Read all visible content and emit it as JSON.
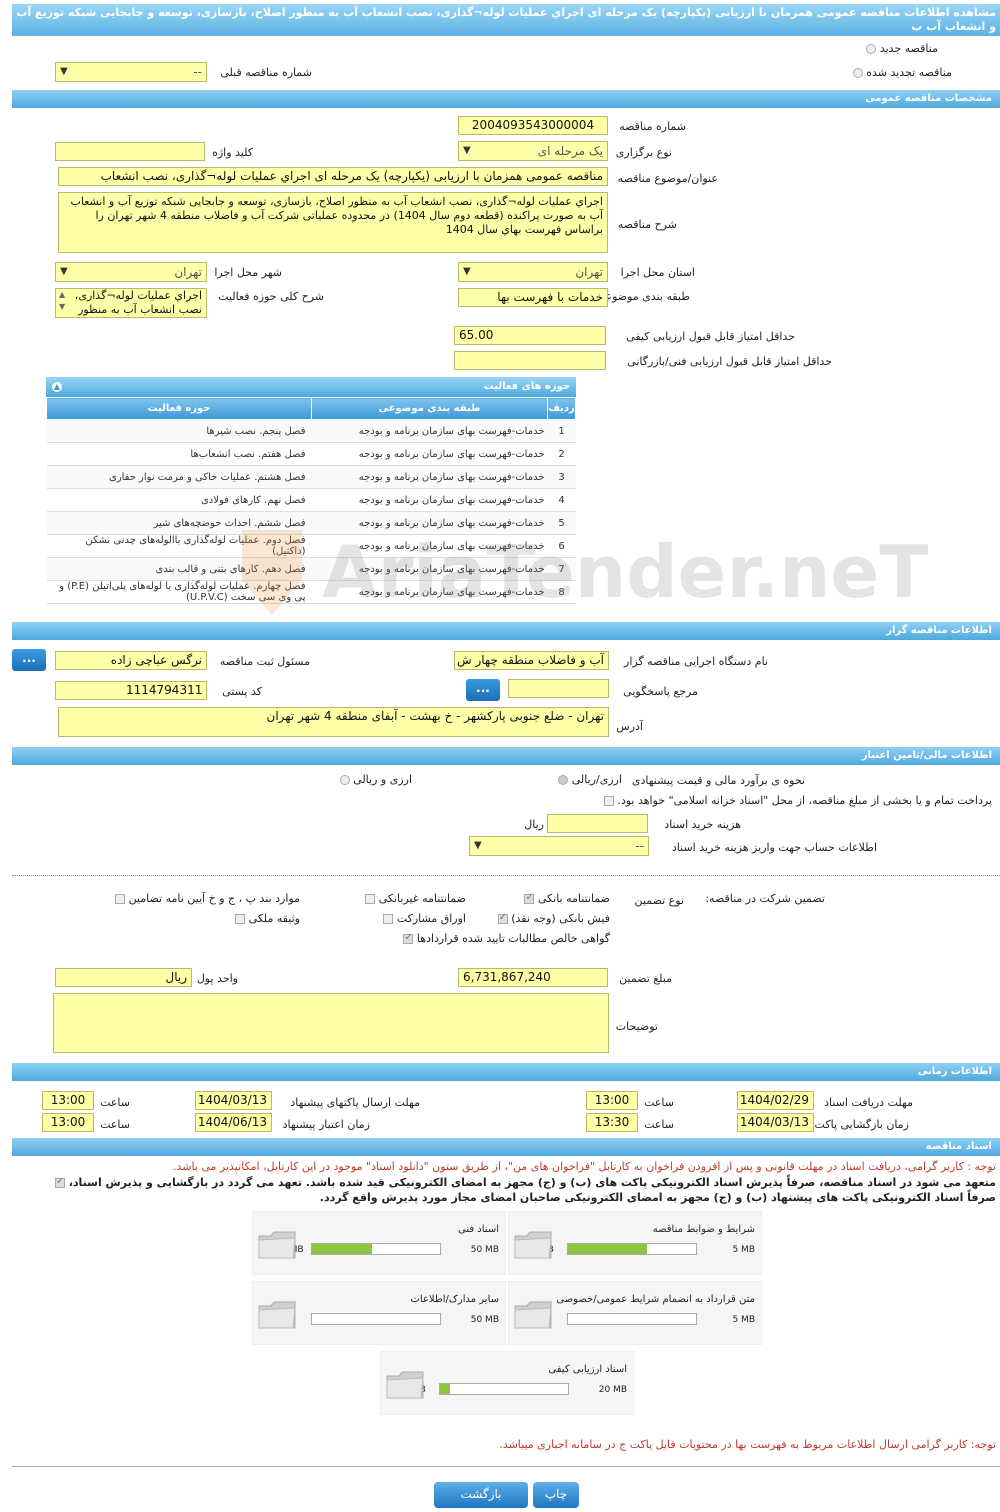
{
  "header": {
    "title": "مشاهده اطلاعات مناقصه عمومی همزمان با ارزیابی (یکپارچه) یک مرحله ای اجراي عمليات لوله¬گذاری، نصب انشعاب آب به منظور اصلاح، بازسازی، توسعه و جابجایی شبکه توزیع آب و انشعاب آب ب"
  },
  "top": {
    "new_tender": "مناقصه جدید",
    "renewed_tender": "مناقصه تجدید شده",
    "previous_number_label": "شماره مناقصه قبلی",
    "previous_number_value": "--"
  },
  "general": {
    "section": "مشخصات مناقصه عمومی",
    "number_label": "شماره مناقصه",
    "number": "2004093543000004",
    "type_label": "نوع برگزاری",
    "type": "یک مرحله ای",
    "keyword_label": "کلید واژه",
    "keyword": "",
    "title_label": "عنوان/موضوع مناقصه",
    "title": "مناقصه عمومی همزمان با ارزیابی (یکپارچه) یک مرحله ای اجراي عمليات لوله¬گذاری، نصب انشعاب",
    "desc_label": "شرح مناقصه",
    "desc": "اجراي عمليات لوله¬گذاری، نصب انشعاب آب به منظور اصلاح، بازسازی، توسعه و جابجایی شبکه توزیع آب و انشعاب آب به صورت پراکنده (قطعه دوم سال 1404) در محدوده عملیاتی شرکت آب و فاضلاب منطقه 4 شهر تهران را براساس فهرست بهاي سال 1404",
    "province_label": "استان محل اجرا",
    "province": "تهران",
    "city_label": "شهر محل اجرا",
    "city": "تهران",
    "category_label": "طبقه بندی موضوعی",
    "category": "خدمات با فهرست بها",
    "scope_label": "شرح کلی حوزه فعالیت",
    "scope": "اجراي عمليات لوله¬گذاری، نصب انشعاب آب به منظور",
    "min_quality_label": "حداقل امتیاز قابل قبول ارزیابی کیفی",
    "min_quality": "65.00",
    "min_tech_label": "حداقل امتیاز قابل قبول ارزیابی فنی/بازرگانی",
    "min_tech": ""
  },
  "activities": {
    "title": "حوزه های فعالیت",
    "col_row": "ردیف",
    "col_category": "طبقه بندی موضوعی",
    "col_field": "حوزه فعالیت",
    "rows": [
      {
        "n": "1",
        "cat": "خدمات-فهرست بهای سازمان برنامه و بودجه",
        "field": "فصل پنجم. نصب شيرها"
      },
      {
        "n": "2",
        "cat": "خدمات-فهرست بهای سازمان برنامه و بودجه",
        "field": "فصل هفتم. نصب انشعاب‌ها"
      },
      {
        "n": "3",
        "cat": "خدمات-فهرست بهای سازمان برنامه و بودجه",
        "field": "فصل هشتم. عملیات خاکی و مرمت نوار حفاری"
      },
      {
        "n": "4",
        "cat": "خدمات-فهرست بهای سازمان برنامه و بودجه",
        "field": "فصل نهم. کارهای فولادی"
      },
      {
        "n": "5",
        "cat": "خدمات-فهرست بهای سازمان برنامه و بودجه",
        "field": "فصل ششم. احداث حوضچه‌های شير"
      },
      {
        "n": "6",
        "cat": "خدمات-فهرست بهای سازمان برنامه و بودجه",
        "field": "فصل دوم. عملیات لوله‌گذاری باالوله‌های چدنی نشکن (داکتیل)"
      },
      {
        "n": "7",
        "cat": "خدمات-فهرست بهای سازمان برنامه و بودجه",
        "field": "فصل دهم. کارهای بتنی و قالب بندی"
      },
      {
        "n": "8",
        "cat": "خدمات-فهرست بهای سازمان برنامه و بودجه",
        "field": "فصل چهارم. عملیات لوله‌گذاری با لوله‌های پلی‌اتیلن (P.E) و پی وی سی سخت (U.P.V.C)"
      }
    ]
  },
  "org": {
    "section": "اطلاعات مناقصه گزار",
    "device_label": "نام دستگاه اجرایی مناقصه گزار",
    "device": "آب و فاضلاب منطقه چهار ش",
    "registrar_label": "مسئول ثبت مناقصه",
    "registrar": "نرگس عباچی زاده",
    "ref_label": "مرجع پاسخگویی",
    "ref": "",
    "postal_label": "کد پستی",
    "postal": "1114794311",
    "address_label": "آدرس",
    "address": "تهران - ضلع جنوبی پارکشهر - خ بهشت - آبفای منطقه 4 شهر تهران",
    "more": "..."
  },
  "finance": {
    "section": "اطلاعات مالی/تامین اعتبار",
    "estimate_label": "نحوه ی برآورد مالی و قیمت پیشنهادی",
    "opt1": "ارزی/ریالی",
    "opt2": "ارزی و ریالی",
    "treasury": "پرداخت تمام و یا بخشی از مبلغ مناقصه، از محل \"اسناد خزانه اسلامی\" خواهد بود.",
    "doc_cost_label": "هزینه خرید اسناد",
    "doc_cost": "",
    "doc_cost_unit": "ریال",
    "account_label": "اطلاعات حساب جهت واریز هزینه خرید اسناد",
    "account": "--"
  },
  "guarantee": {
    "participation_label": "تضمین شرکت در مناقصه:",
    "type_label": "نوع تضمین",
    "bank_guarantee": "ضمانتنامه بانکی",
    "nonbank_guarantee": "ضمانتنامه غیربانکی",
    "clauses": "موارد بند پ ، ج و خ آیین نامه تضامین",
    "cash": "فیش بانکی (وجه نقد)",
    "bonds": "اوراق مشارکت",
    "property": "وثیقه ملکی",
    "receivables": "گواهی خالص مطالبات تایید شده قراردادها",
    "amount_label": "مبلغ تضمین",
    "amount": "6,731,867,240",
    "currency_label": "واحد پول",
    "currency": "ریال",
    "notes_label": "توضیحات",
    "notes": ""
  },
  "timing": {
    "section": "اطلاعات زمانی",
    "doc_receive_label": "مهلت دریافت اسناد",
    "doc_receive_date": "1404/02/29",
    "doc_receive_time": "13:00",
    "send_label": "مهلت ارسال پاکتهای پیشنهاد",
    "send_date": "1404/03/13",
    "send_time": "13:00",
    "open_label": "زمان بازگشایی پاکت ها",
    "open_date": "1404/03/13",
    "open_time": "13:30",
    "valid_label": "زمان اعتبار پیشنهاد",
    "valid_date": "1404/06/13",
    "valid_time": "13:00",
    "time_label": "ساعت"
  },
  "docs": {
    "section": "اسناد مناقصه",
    "note1": "توجه : کاربر گرامی، دریافت اسناد در مهلت قانونی و پس از افزودن فراخوان به کارتابل \"فراخوان های من\"، از طریق ستون \"دانلود اسناد\" موجود در این کارتابل، امکانپذیر می باشد.",
    "pledge1": "متعهد می شود در اسناد مناقصه، صرفاً پذیرش اسناد الکترونیکی پاکت های (ب) و (ج) مجهز به امضای الکترونیکی قید شده باشد. تعهد می گردد در بازگشایی و پذیرش اسناد،",
    "pledge2": "صرفاً اسناد الکترونیکی پاکت های پیشنهاد (ب) و (ج) مجهز به امضای الکترونیکی صاحبان امضای مجاز مورد پذیرش واقع گردد.",
    "items": [
      {
        "name": "شرایط و ضوابط مناقصه",
        "used": "3.08 MB",
        "max": "5 MB",
        "pct": 0.62
      },
      {
        "name": "اسناد فنی",
        "used": "23.49 MB",
        "max": "50 MB",
        "pct": 0.47
      },
      {
        "name": "متن قرارداد به انضمام شرایط عمومی/خصوصی",
        "used": "0 MB",
        "max": "5 MB",
        "pct": 0
      },
      {
        "name": "سایر مدارک/اطلاعات",
        "used": "0 MB",
        "max": "50 MB",
        "pct": 0
      },
      {
        "name": "اسناد ارزیابی کیفی",
        "used": "1.63 MB",
        "max": "20 MB",
        "pct": 0.08
      }
    ],
    "note2": "توجه: کاربر گرامی ارسال اطلاعات مربوط به فهرست بها در محتویات فایل پاکت ج در سامانه اجباری میباشد."
  },
  "actions": {
    "print": "چاپ",
    "back": "بازگشت"
  },
  "watermark": "AriaTender.neT"
}
